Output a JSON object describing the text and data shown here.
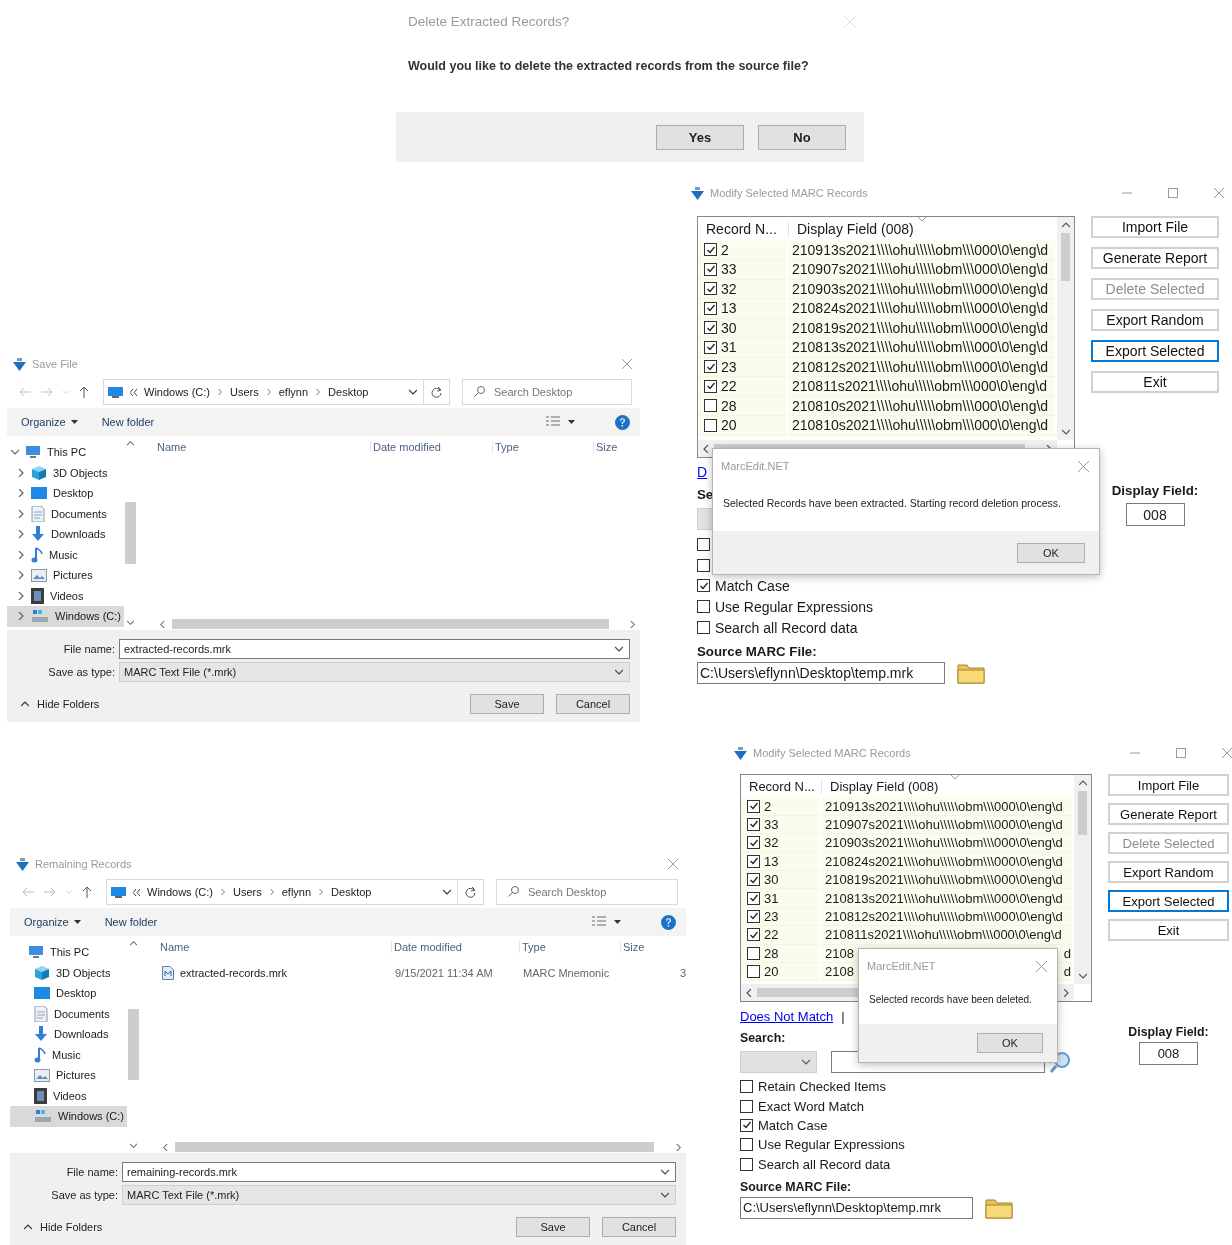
{
  "delete_prompt": {
    "title": "Delete Extracted Records?",
    "message": "Would you like to delete the extracted records from the source file?",
    "buttons": [
      "Yes",
      "No"
    ]
  },
  "save_dialogs": [
    {
      "title": "Save File",
      "path": [
        "Windows (C:)",
        "Users",
        "eflynn",
        "Desktop"
      ],
      "search_placeholder": "Search Desktop",
      "organize": "Organize",
      "new_folder": "New folder",
      "nav": [
        {
          "label": "This PC",
          "kind": "pc",
          "expanded": true,
          "selected": false,
          "children": [
            {
              "label": "3D Objects",
              "kind": "cube",
              "expanded": false,
              "selected": false
            },
            {
              "label": "Desktop",
              "kind": "desktop",
              "expanded": false,
              "selected": false
            },
            {
              "label": "Documents",
              "kind": "documents",
              "expanded": false,
              "selected": false
            },
            {
              "label": "Downloads",
              "kind": "downloads",
              "expanded": false,
              "selected": false
            },
            {
              "label": "Music",
              "kind": "music",
              "expanded": false,
              "selected": false
            },
            {
              "label": "Pictures",
              "kind": "pictures",
              "expanded": false,
              "selected": false
            },
            {
              "label": "Videos",
              "kind": "videos",
              "expanded": false,
              "selected": false
            },
            {
              "label": "Windows (C:)",
              "kind": "drive",
              "expanded": false,
              "selected": true
            }
          ]
        }
      ],
      "columns": [
        "Name",
        "Date modified",
        "Type",
        "Size"
      ],
      "file_name_label": "File name:",
      "file_name": "extracted-records.mrk",
      "type_label": "Save as type:",
      "type": "MARC Text File (*.mrk)",
      "hide_folders": "Hide Folders",
      "buttons": [
        "Save",
        "Cancel"
      ]
    },
    {
      "title": "Remaining Records",
      "path": [
        "Windows (C:)",
        "Users",
        "eflynn",
        "Desktop"
      ],
      "search_placeholder": "Search Desktop",
      "organize": "Organize",
      "new_folder": "New folder",
      "nav": [
        {
          "label": "This PC",
          "kind": "pc",
          "selected": false,
          "children": [
            {
              "label": "3D Objects",
              "kind": "cube",
              "selected": false
            },
            {
              "label": "Desktop",
              "kind": "desktop",
              "selected": false
            },
            {
              "label": "Documents",
              "kind": "documents",
              "selected": false
            },
            {
              "label": "Downloads",
              "kind": "downloads",
              "selected": false
            },
            {
              "label": "Music",
              "kind": "music",
              "selected": false
            },
            {
              "label": "Pictures",
              "kind": "pictures",
              "selected": false
            },
            {
              "label": "Videos",
              "kind": "videos",
              "selected": false
            },
            {
              "label": "Windows (C:)",
              "kind": "drive",
              "selected": true
            }
          ]
        }
      ],
      "columns": [
        "Name",
        "Date modified",
        "Type",
        "Size"
      ],
      "files": [
        {
          "name": "extracted-records.mrk",
          "date": "9/15/2021 11:34 AM",
          "type": "MARC Mnemonic",
          "size": "3"
        }
      ],
      "file_name_label": "File name:",
      "file_name": "remaining-records.mrk",
      "type_label": "Save as type:",
      "type": "MARC Text File (*.mrk)",
      "hide_folders": "Hide Folders",
      "buttons": [
        "Save",
        "Cancel"
      ]
    }
  ],
  "marc_windows": [
    {
      "title": "Modify Selected MARC Records",
      "columns": [
        "Record N...",
        "Display Field (008)"
      ],
      "rows": [
        {
          "number": "2",
          "checked": true,
          "field": "210913s2021\\\\\\\\ohu\\\\\\\\\\obm\\\\\\000\\0\\eng\\d"
        },
        {
          "number": "33",
          "checked": true,
          "field": "210907s2021\\\\\\\\ohu\\\\\\\\\\obm\\\\\\000\\0\\eng\\d"
        },
        {
          "number": "32",
          "checked": true,
          "field": "210903s2021\\\\\\\\ohu\\\\\\\\\\obm\\\\\\000\\0\\eng\\d"
        },
        {
          "number": "13",
          "checked": true,
          "field": "210824s2021\\\\\\\\ohu\\\\\\\\\\obm\\\\\\000\\0\\eng\\d"
        },
        {
          "number": "30",
          "checked": true,
          "field": "210819s2021\\\\\\\\ohu\\\\\\\\\\obm\\\\\\000\\0\\eng\\d"
        },
        {
          "number": "31",
          "checked": true,
          "field": "210813s2021\\\\\\\\ohu\\\\\\\\\\obm\\\\\\000\\0\\eng\\d"
        },
        {
          "number": "23",
          "checked": true,
          "field": "210812s2021\\\\\\\\ohu\\\\\\\\\\obm\\\\\\000\\0\\eng\\d"
        },
        {
          "number": "22",
          "checked": true,
          "field": "210811s2021\\\\\\\\ohu\\\\\\\\\\obm\\\\\\000\\0\\eng\\d"
        },
        {
          "number": "28",
          "checked": false,
          "field": "210810s2021\\\\\\\\ohu\\\\\\\\\\obm\\\\\\000\\0\\eng\\d"
        },
        {
          "number": "20",
          "checked": false,
          "field": "210810s2021\\\\\\\\ohu\\\\\\\\\\obm\\\\\\000\\0\\eng\\d"
        }
      ],
      "buttons": [
        {
          "label": "Import File",
          "disabled": false,
          "focused": false
        },
        {
          "label": "Generate Report",
          "disabled": false,
          "focused": false
        },
        {
          "label": "Delete Selected",
          "disabled": true,
          "focused": false
        },
        {
          "label": "Export Random",
          "disabled": false,
          "focused": false
        },
        {
          "label": "Export Selected",
          "disabled": false,
          "focused": true
        },
        {
          "label": "Exit",
          "disabled": false,
          "focused": false
        }
      ],
      "link": {
        "text": "D"
      },
      "search_label": "Se",
      "options": [
        {
          "checked": false
        },
        {
          "checked": false
        },
        {
          "label": "Match Case",
          "checked": true
        },
        {
          "label": "Use Regular Expressions",
          "checked": false
        },
        {
          "label": "Search all Record data",
          "checked": false
        }
      ],
      "display_label": "Display Field:",
      "display_value": "008",
      "source_label": "Source MARC File:",
      "source_path": "C:\\Users\\eflynn\\Desktop\\temp.mrk",
      "message": {
        "title": "MarcEdit.NET",
        "text": "Selected Records have been extracted. Starting record deletion process.",
        "button": "OK"
      }
    },
    {
      "title": "Modify Selected MARC Records",
      "columns": [
        "Record N...",
        "Display Field (008)"
      ],
      "rows": [
        {
          "number": "2",
          "checked": true,
          "field": "210913s2021\\\\\\\\ohu\\\\\\\\\\obm\\\\\\000\\0\\eng\\d"
        },
        {
          "number": "33",
          "checked": true,
          "field": "210907s2021\\\\\\\\ohu\\\\\\\\\\obm\\\\\\000\\0\\eng\\d"
        },
        {
          "number": "32",
          "checked": true,
          "field": "210903s2021\\\\\\\\ohu\\\\\\\\\\obm\\\\\\000\\0\\eng\\d"
        },
        {
          "number": "13",
          "checked": true,
          "field": "210824s2021\\\\\\\\ohu\\\\\\\\\\obm\\\\\\000\\0\\eng\\d"
        },
        {
          "number": "30",
          "checked": true,
          "field": "210819s2021\\\\\\\\ohu\\\\\\\\\\obm\\\\\\000\\0\\eng\\d"
        },
        {
          "number": "31",
          "checked": true,
          "field": "210813s2021\\\\\\\\ohu\\\\\\\\\\obm\\\\\\000\\0\\eng\\d"
        },
        {
          "number": "23",
          "checked": true,
          "field": "210812s2021\\\\\\\\ohu\\\\\\\\\\obm\\\\\\000\\0\\eng\\d"
        },
        {
          "number": "22",
          "checked": true,
          "field": "210811s2021\\\\\\\\ohu\\\\\\\\\\obm\\\\\\000\\0\\eng\\d"
        },
        {
          "number": "28",
          "checked": false,
          "field": "2108",
          "field_end": "d"
        },
        {
          "number": "20",
          "checked": false,
          "field": "2108",
          "field_end": "d"
        }
      ],
      "buttons": [
        {
          "label": "Import File",
          "disabled": false,
          "focused": false
        },
        {
          "label": "Generate Report",
          "disabled": false,
          "focused": false
        },
        {
          "label": "Delete Selected",
          "disabled": true,
          "focused": false
        },
        {
          "label": "Export Random",
          "disabled": false,
          "focused": false
        },
        {
          "label": "Export Selected",
          "disabled": false,
          "focused": true
        },
        {
          "label": "Exit",
          "disabled": false,
          "focused": false
        }
      ],
      "link": {
        "text": "Does Not Match",
        "separator": "|"
      },
      "search_label": "Search:",
      "options": [
        {
          "label": "Retain Checked Items",
          "checked": false
        },
        {
          "label": "Exact Word Match",
          "checked": false
        },
        {
          "label": "Match Case",
          "checked": true
        },
        {
          "label": "Use Regular Expressions",
          "checked": false
        },
        {
          "label": "Search all Record data",
          "checked": false
        }
      ],
      "display_label": "Display Field:",
      "display_value": "008",
      "source_label": "Source MARC File:",
      "source_path": "C:\\Users\\eflynn\\Desktop\\temp.mrk",
      "message": {
        "title": "MarcEdit.NET",
        "text": "Selected records have been deleted.",
        "button": "OK"
      }
    }
  ]
}
